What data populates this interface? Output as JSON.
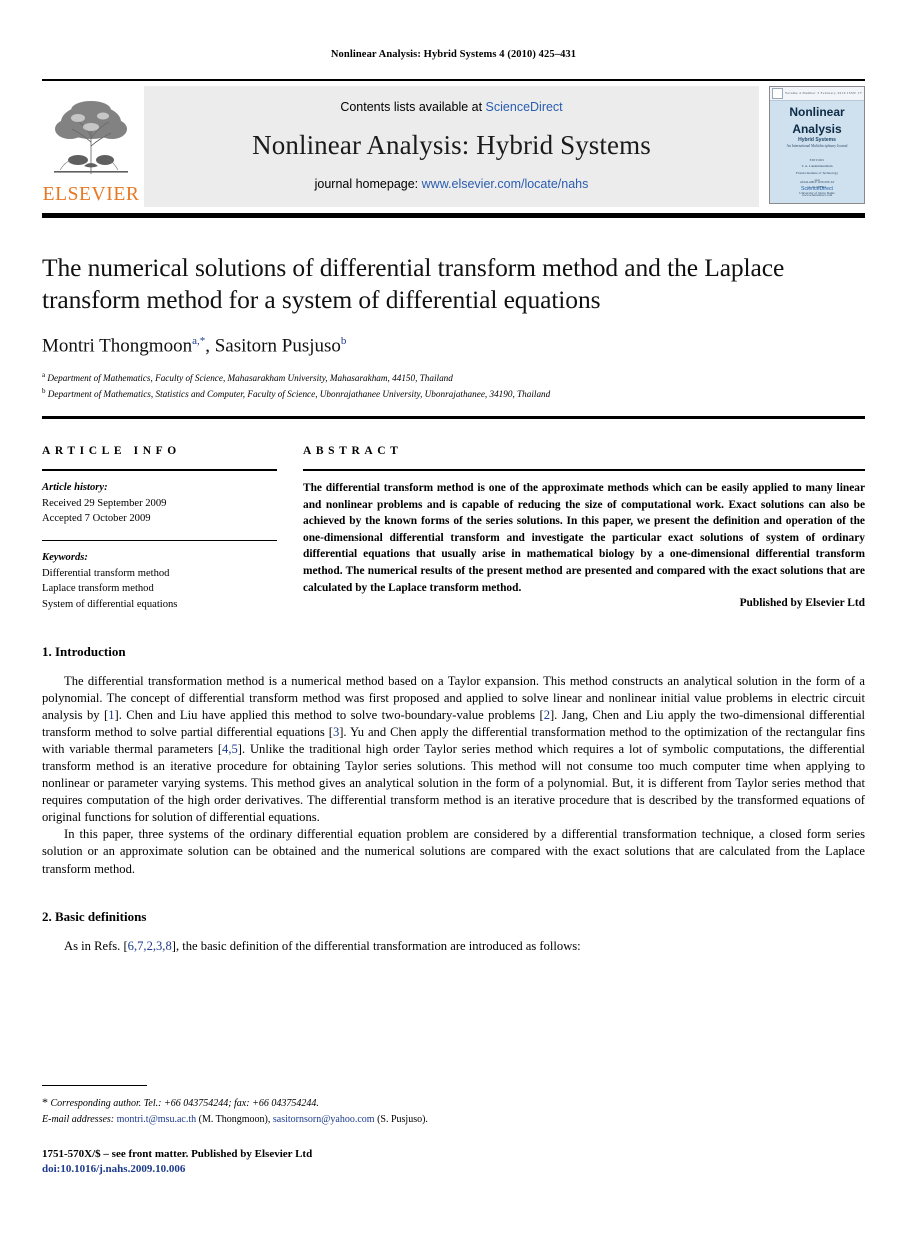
{
  "running_head": "Nonlinear Analysis: Hybrid Systems 4 (2010) 425–431",
  "masthead": {
    "publisher_logo_text": "ELSEVIER",
    "contents_prefix": "Contents lists available at ",
    "contents_link": "ScienceDirect",
    "journal_title": "Nonlinear Analysis: Hybrid Systems",
    "homepage_prefix": "journal homepage: ",
    "homepage_url": "www.elsevier.com/locate/nahs",
    "cover": {
      "masthead_meta": "Volume 4   Number 3   February 2010   ISSN 1751-570X",
      "title_line1": "Nonlinear",
      "title_line2": "Analysis",
      "subtitle": "Hybrid Systems",
      "tagline": "An International Multidisciplinary Journal",
      "editors_label": "EDITORS",
      "editor1": "T. A. Lakshmikantham",
      "editor1_aff": "Florida Institute of Technology",
      "and_label": "and",
      "editor2": "A. N. Michel",
      "editor2_aff": "University of Notre Dame",
      "available_label": "AVAILABLE ONLINE AT",
      "sciencedirect": "ScienceDirect",
      "sd_url": "www.sciencedirect.com"
    }
  },
  "article": {
    "title": "The numerical solutions of differential transform method and the Laplace transform method for a system of differential equations",
    "authors": [
      {
        "name": "Montri Thongmoon",
        "marks": "a,*"
      },
      {
        "name": "Sasitorn Pusjuso",
        "marks": "b"
      }
    ],
    "affiliations": [
      {
        "mark": "a",
        "text": "Department of Mathematics, Faculty of Science, Mahasarakham University, Mahasarakham, 44150, Thailand"
      },
      {
        "mark": "b",
        "text": "Department of Mathematics, Statistics and Computer, Faculty of Science, Ubonrajathanee University, Ubonrajathanee, 34190, Thailand"
      }
    ]
  },
  "article_info": {
    "heading": "ARTICLE INFO",
    "history_label": "Article history:",
    "history": [
      "Received 29 September 2009",
      "Accepted 7 October 2009"
    ],
    "keywords_label": "Keywords:",
    "keywords": [
      "Differential transform method",
      "Laplace transform method",
      "System of differential equations"
    ]
  },
  "abstract": {
    "heading": "ABSTRACT",
    "text": "The differential transform method is one of the approximate methods which can be easily applied to many linear and nonlinear problems and is capable of reducing the size of computational work. Exact solutions can also be achieved by the known forms of the series solutions. In this paper, we present the definition and operation of the one-dimensional differential transform and investigate the particular exact solutions of system of ordinary differential equations that usually arise in mathematical biology by a one-dimensional differential transform method. The numerical results of the present method are presented and compared with the exact solutions that are calculated by the Laplace transform method.",
    "published_by": "Published by Elsevier Ltd"
  },
  "sections": [
    {
      "heading": "1. Introduction",
      "paragraphs": [
        "The differential transformation method is a numerical method based on a Taylor expansion. This method constructs an analytical solution in the form of a polynomial. The concept of differential transform method was first proposed and applied to solve linear and nonlinear initial value problems in electric circuit analysis by [1]. Chen and Liu have applied this method to solve two-boundary-value problems [2]. Jang, Chen and Liu apply the two-dimensional differential transform method to solve partial differential equations [3]. Yu and Chen apply the differential transformation method to the optimization of the rectangular fins with variable thermal parameters [4,5]. Unlike the traditional high order Taylor series method which requires a lot of symbolic computations, the differential transform method is an iterative procedure for obtaining Taylor series solutions. This method will not consume too much computer time when applying to nonlinear or parameter varying systems. This method gives an analytical solution in the form of a polynomial. But, it is different from Taylor series method that requires computation of the high order derivatives. The differential transform method is an iterative procedure that is described by the transformed equations of original functions for solution of differential equations.",
        "In this paper, three systems of the ordinary differential equation problem are considered by a differential transformation technique, a closed form series solution or an approximate solution can be obtained and the numerical solutions are compared with the exact solutions that are calculated from the Laplace transform method."
      ]
    },
    {
      "heading": "2. Basic definitions",
      "paragraphs": [
        "As in Refs. [6,7,2,3,8], the basic definition of the differential transformation are introduced as follows:"
      ]
    }
  ],
  "footnotes": {
    "corresponding": "Corresponding author. Tel.: +66 043754244; fax: +66 043754244.",
    "email_label": "E-mail addresses:",
    "email1": "montri.t@msu.ac.th",
    "email1_owner": "(M. Thongmoon),",
    "email2": "sasitornsorn@yahoo.com",
    "email2_owner": "(S. Pusjuso).",
    "copyright": "1751-570X/$ – see front matter. Published by Elsevier Ltd",
    "doi": "doi:10.1016/j.nahs.2009.10.006"
  },
  "colors": {
    "link": "#1b3a8c",
    "elsevier_orange": "#E87722",
    "band_gray": "#ececec",
    "cover_blue": "#cfe0ee"
  }
}
